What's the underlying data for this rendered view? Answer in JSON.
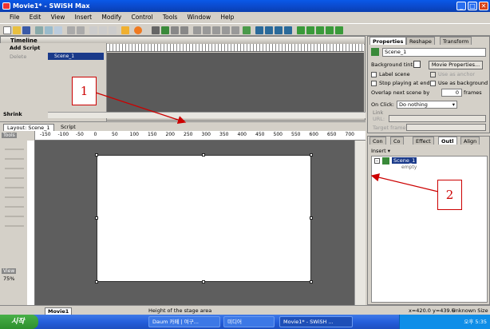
{
  "window": {
    "title": "Movie1* - SWiSH Max"
  },
  "menu": [
    "File",
    "Edit",
    "View",
    "Insert",
    "Modify",
    "Control",
    "Tools",
    "Window",
    "Help"
  ],
  "timeline": {
    "title": "Timeline",
    "add_script": "Add Script",
    "delete": "Delete",
    "scene_label": "Scene_1",
    "shrink": "Shrink"
  },
  "stage": {
    "tabs": [
      "Layout: Scene_1",
      "Script"
    ],
    "ruler_labels": [
      "-150",
      "-100",
      "-50",
      "0",
      "50",
      "100",
      "150",
      "200",
      "250",
      "300",
      "350",
      "400",
      "450",
      "500",
      "550",
      "600",
      "650",
      "700"
    ],
    "zoom": "75%",
    "view_label": "View",
    "tools_label": "Tools"
  },
  "status": {
    "scene_tab": "Movie1",
    "message": "Height of the stage area",
    "coords": "x=420.0 y=439.6",
    "size": "Unknown Size"
  },
  "properties": {
    "tabs": [
      "Properties",
      "Reshape",
      "Transform"
    ],
    "name_value": "Scene_1",
    "background_tint_label": "Background tint:",
    "movie_properties_button": "Movie Properties...",
    "label_scene": "Label scene",
    "use_as_anchor": "Use as anchor",
    "stop_playing": "Stop playing at end",
    "use_as_background": "Use as background",
    "overlap_label": "Overlap next scene by",
    "overlap_value": "0",
    "overlap_unit": "frames",
    "on_click_label": "On Click:",
    "on_click_value": "Do nothing",
    "link_label": "Link",
    "url_label": "URL:",
    "target_frame_label": "Target frame:"
  },
  "outline": {
    "tabs": [
      "Con",
      "Co",
      "Effect",
      "Outl",
      "Align"
    ],
    "insert_label": "Insert",
    "scene_item": "Scene_1",
    "scene_sub": "empty"
  },
  "taskbar": {
    "start": "시작",
    "tasks": [
      "Daum 카페 | 여구...",
      "미디어",
      "Movie1* - SWiSH ..."
    ],
    "clock": "오후 5:35"
  },
  "annotations": {
    "label_1": "1",
    "label_2": "2",
    "arrow_color": "#cc0000"
  }
}
